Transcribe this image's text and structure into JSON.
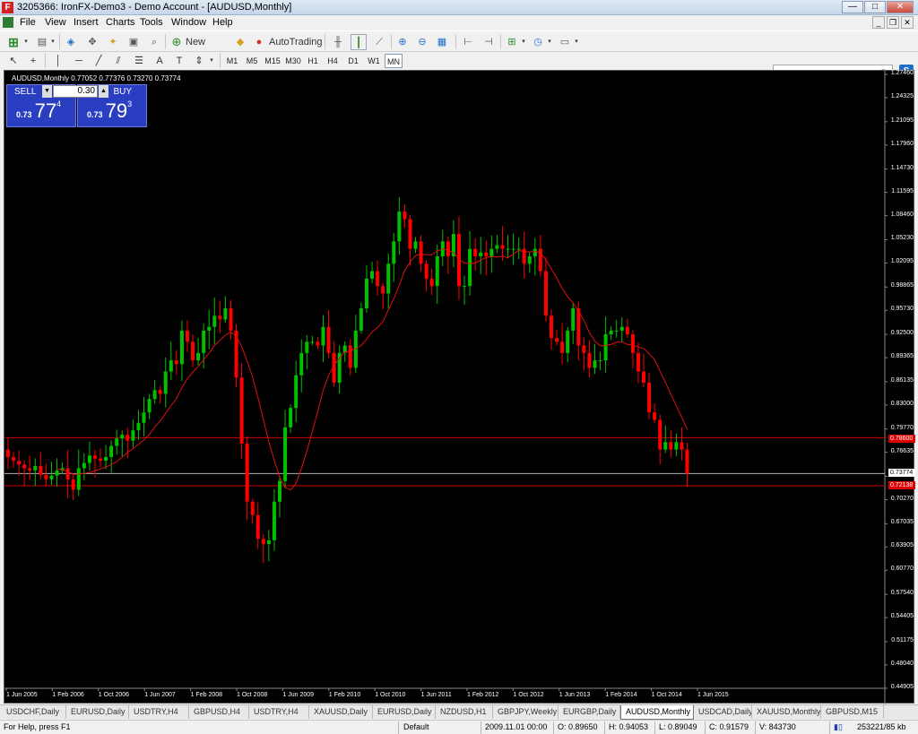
{
  "window": {
    "title": "3205366: IronFX-Demo3 - Demo Account - [AUDUSD,Monthly]",
    "icon": "F",
    "controls": [
      "—",
      "□",
      "✕"
    ]
  },
  "menu": {
    "items": [
      "File",
      "View",
      "Insert",
      "Charts",
      "Tools",
      "Window",
      "Help"
    ],
    "mdi_controls": [
      "_",
      "❐",
      "✕"
    ]
  },
  "toolbar": {
    "new_order": "New Order",
    "autotrading": "AutoTrading"
  },
  "timeframes": [
    "M1",
    "M5",
    "M15",
    "M30",
    "H1",
    "H4",
    "D1",
    "W1",
    "MN"
  ],
  "active_timeframe": "MN",
  "chart": {
    "label": "AUDUSD,Monthly  0.77052 0.77376 0.73270 0.73774",
    "background": "#000000",
    "bull_color": "#00c000",
    "bear_color": "#ff0000",
    "ma_color": "#e01010"
  },
  "one_click": {
    "sell_label": "SELL",
    "buy_label": "BUY",
    "lots": "0.30",
    "sell_price": {
      "big": "0.73",
      "main": "77",
      "sup": "4"
    },
    "buy_price": {
      "big": "0.73",
      "main": "79",
      "sup": "3"
    }
  },
  "price_ticks": [
    "1.27460",
    "1.24325",
    "1.21095",
    "1.17960",
    "1.14730",
    "1.11595",
    "1.08460",
    "1.05230",
    "1.02095",
    "0.98865",
    "0.95730",
    "0.92500",
    "0.89365",
    "0.86135",
    "0.83000",
    "0.79770",
    "0.76635",
    "0.73405",
    "0.70270",
    "0.67035",
    "0.63905",
    "0.60770",
    "0.57540",
    "0.54405",
    "0.51175",
    "0.48040",
    "0.44905"
  ],
  "price_tags": {
    "upper_line": "0.78600",
    "current": "0.73774",
    "lower_line": "0.72138"
  },
  "time_ticks": [
    "1 Jun 2005",
    "1 Feb 2006",
    "1 Oct 2006",
    "1 Jun 2007",
    "1 Feb 2008",
    "1 Oct 2008",
    "1 Jun 2009",
    "1 Feb 2010",
    "1 Oct 2010",
    "1 Jun 2011",
    "1 Feb 2012",
    "1 Oct 2012",
    "1 Jun 2013",
    "1 Feb 2014",
    "1 Oct 2014",
    "1 Jun 2015"
  ],
  "tabs": [
    "USDCHF,Daily",
    "EURUSD,Daily",
    "USDTRY,H4",
    "GBPUSD,H4",
    "USDTRY,H4",
    "XAUUSD,Daily",
    "EURUSD,Daily",
    "NZDUSD,H1",
    "GBPJPY,Weekly",
    "EURGBP,Daily",
    "AUDUSD,Monthly",
    "USDCAD,Daily",
    "XAUUSD,Monthly",
    "GBPUSD,M15"
  ],
  "active_tab": "AUDUSD,Monthly",
  "status": {
    "help": "For Help, press F1",
    "profile": "Default",
    "datetime": "2009.11.01 00:00",
    "open": "O: 0.89650",
    "high": "H: 0.94053",
    "low": "L: 0.89049",
    "close": "C: 0.91579",
    "volume": "V: 843730",
    "traffic": "253221/85 kb"
  },
  "chart_data": {
    "type": "candlestick",
    "symbol": "AUDUSD",
    "timeframe": "Monthly",
    "y_axis_ticks": [
      1.2746,
      1.24325,
      1.21095,
      1.1796,
      1.1473,
      1.11595,
      1.0846,
      1.0523,
      1.02095,
      0.98865,
      0.9573,
      0.925,
      0.89365,
      0.86135,
      0.83,
      0.7977,
      0.76635,
      0.73405,
      0.7027,
      0.67035,
      0.63905,
      0.6077,
      0.5754,
      0.54405,
      0.51175,
      0.4804,
      0.44905
    ],
    "ylim": [
      0.449,
      1.2746
    ],
    "x_axis_ticks": [
      "1 Jun 2005",
      "1 Feb 2006",
      "1 Oct 2006",
      "1 Jun 2007",
      "1 Feb 2008",
      "1 Oct 2008",
      "1 Jun 2009",
      "1 Feb 2010",
      "1 Oct 2010",
      "1 Jun 2011",
      "1 Feb 2012",
      "1 Oct 2012",
      "1 Jun 2013",
      "1 Feb 2014",
      "1 Oct 2014",
      "1 Jun 2015"
    ],
    "horizontal_lines": [
      0.786,
      0.73774,
      0.72138
    ],
    "last_bar": {
      "open": 0.77052,
      "high": 0.77376,
      "low": 0.7327,
      "close": 0.73774
    },
    "close_path": [
      0.76,
      0.755,
      0.75,
      0.745,
      0.742,
      0.748,
      0.736,
      0.73,
      0.735,
      0.742,
      0.745,
      0.73,
      0.716,
      0.745,
      0.752,
      0.762,
      0.758,
      0.755,
      0.76,
      0.775,
      0.785,
      0.79,
      0.782,
      0.796,
      0.806,
      0.82,
      0.838,
      0.85,
      0.845,
      0.875,
      0.89,
      0.885,
      0.93,
      0.915,
      0.89,
      0.9,
      0.93,
      0.935,
      0.95,
      0.945,
      0.96,
      0.93,
      0.867,
      0.778,
      0.7,
      0.682,
      0.65,
      0.643,
      0.648,
      0.7,
      0.7277,
      0.8,
      0.826,
      0.87,
      0.9,
      0.915,
      0.915,
      0.91,
      0.935,
      0.9,
      0.86,
      0.9,
      0.91,
      0.88,
      0.93,
      0.96,
      1.0,
      1.01,
      0.99,
      0.98,
      1.02,
      1.05,
      1.09,
      1.08,
      1.04,
      1.05,
      1.02,
      1.0,
      0.99,
      1.03,
      1.05,
      1.03,
      1.06,
      0.99,
      0.99,
      1.04,
      1.03,
      1.035,
      1.03,
      1.04,
      1.045,
      1.04,
      1.04,
      1.04,
      1.04,
      1.02,
      1.03,
      1.04,
      1.01,
      0.95,
      0.92,
      0.915,
      0.9,
      0.93,
      0.96,
      0.91,
      0.9,
      0.88,
      0.89,
      0.89,
      0.925,
      0.93,
      0.93,
      0.935,
      0.925,
      0.9,
      0.875,
      0.86,
      0.82,
      0.81,
      0.77,
      0.78,
      0.77,
      0.78,
      0.77,
      0.7377
    ]
  }
}
